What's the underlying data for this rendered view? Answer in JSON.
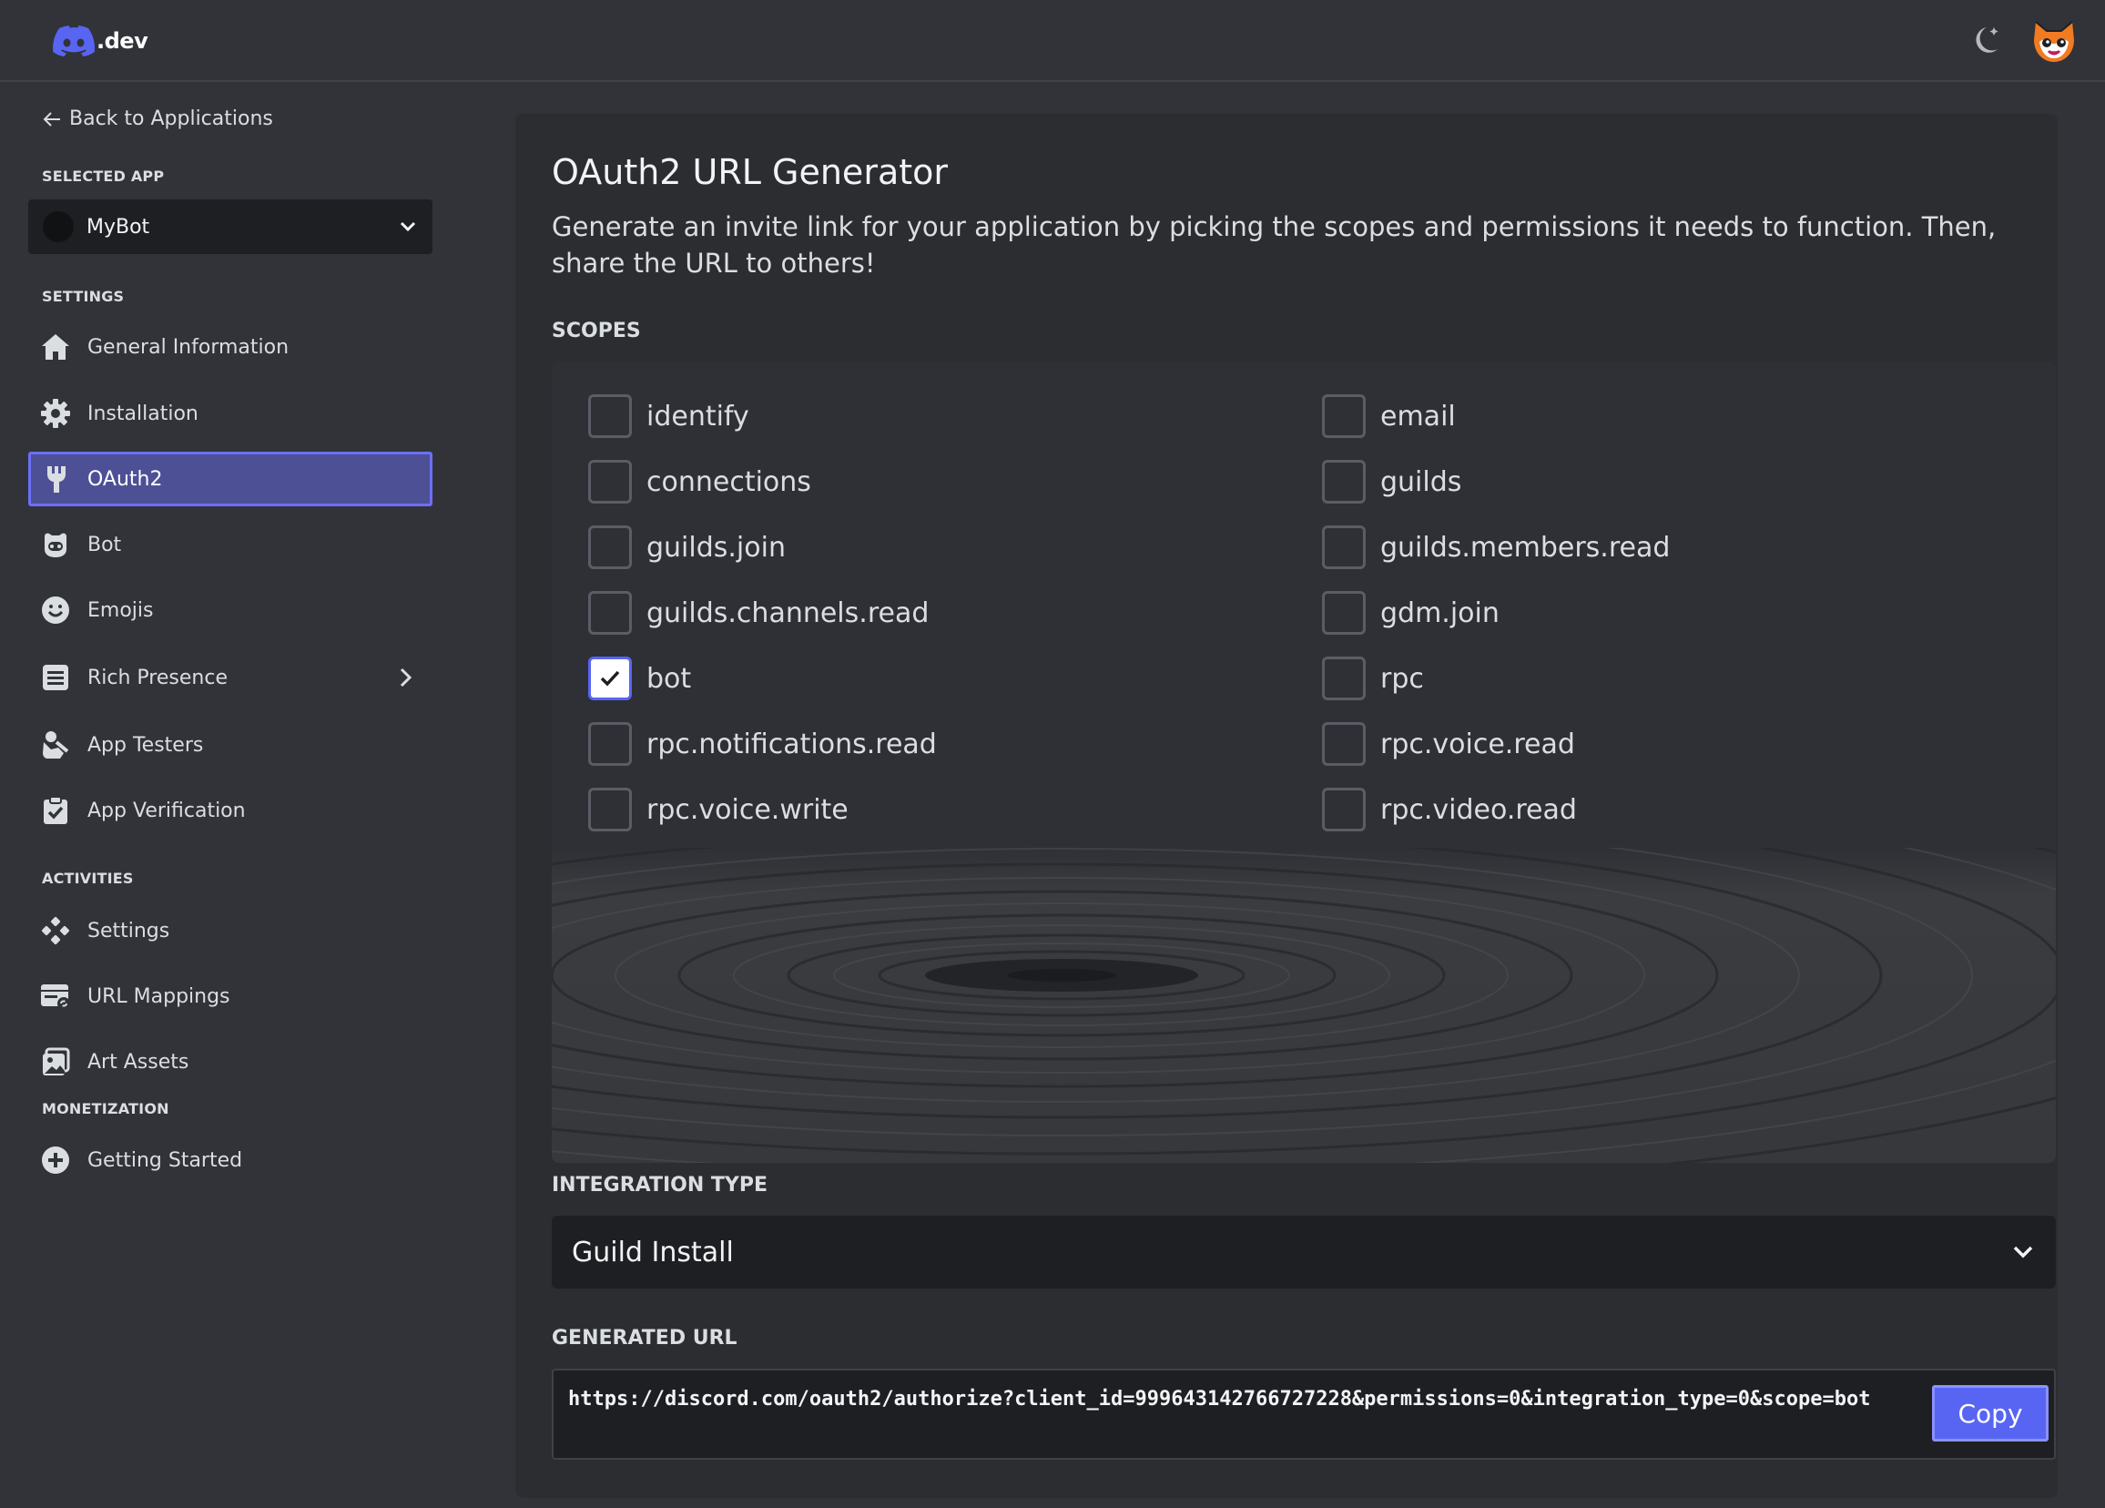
{
  "header": {
    "logo_text": ".dev"
  },
  "sidebar": {
    "back_label": "Back to Applications",
    "selected_app_label": "SELECTED APP",
    "app_name": "MyBot",
    "settings_label": "SETTINGS",
    "activities_label": "ACTIVITIES",
    "monetization_label": "MONETIZATION",
    "items": [
      {
        "label": "General Information",
        "icon": "home-icon"
      },
      {
        "label": "Installation",
        "icon": "gear-icon"
      },
      {
        "label": "OAuth2",
        "icon": "wrench-icon",
        "active": true
      },
      {
        "label": "Bot",
        "icon": "robot-icon"
      },
      {
        "label": "Emojis",
        "icon": "smiley-icon"
      },
      {
        "label": "Rich Presence",
        "icon": "document-icon",
        "expandable": true
      },
      {
        "label": "App Testers",
        "icon": "user-testers-icon"
      },
      {
        "label": "App Verification",
        "icon": "clipboard-check-icon"
      }
    ],
    "activities": [
      {
        "label": "Settings",
        "icon": "gamepad-icon"
      },
      {
        "label": "URL Mappings",
        "icon": "browser-link-icon"
      },
      {
        "label": "Art Assets",
        "icon": "image-icon"
      }
    ],
    "monetization": [
      {
        "label": "Getting Started",
        "icon": "plus-circle-icon"
      }
    ]
  },
  "main": {
    "title": "OAuth2 URL Generator",
    "description": "Generate an invite link for your application by picking the scopes and permissions it needs to function. Then, share the URL to others!",
    "scopes_label": "SCOPES",
    "scopes_left": [
      {
        "label": "identify",
        "checked": false
      },
      {
        "label": "connections",
        "checked": false
      },
      {
        "label": "guilds.join",
        "checked": false
      },
      {
        "label": "guilds.channels.read",
        "checked": false
      },
      {
        "label": "bot",
        "checked": true
      },
      {
        "label": "rpc.notifications.read",
        "checked": false
      },
      {
        "label": "rpc.voice.write",
        "checked": false
      }
    ],
    "scopes_right": [
      {
        "label": "email",
        "checked": false
      },
      {
        "label": "guilds",
        "checked": false
      },
      {
        "label": "guilds.members.read",
        "checked": false
      },
      {
        "label": "gdm.join",
        "checked": false
      },
      {
        "label": "rpc",
        "checked": false
      },
      {
        "label": "rpc.voice.read",
        "checked": false
      },
      {
        "label": "rpc.video.read",
        "checked": false
      }
    ],
    "integration_type_label": "INTEGRATION TYPE",
    "integration_type_value": "Guild Install",
    "generated_url_label": "GENERATED URL",
    "generated_url": "https://discord.com/oauth2/authorize?client_id=999643142766727228&permissions=0&integration_type=0&scope=bot",
    "copy_label": "Copy"
  },
  "colors": {
    "accent": "#5865f2",
    "background": "#313338",
    "panel": "#2b2d31",
    "input": "#1e1f22"
  }
}
